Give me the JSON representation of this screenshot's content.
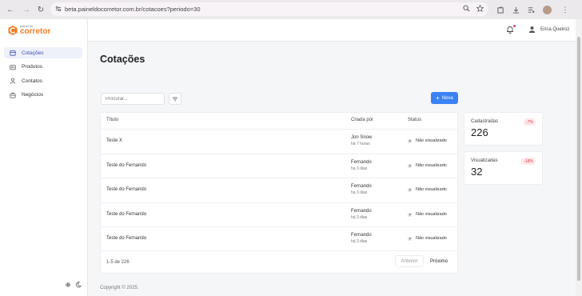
{
  "browser": {
    "url": "beta.paineldocorretor.com.br/cotacoes?periodo=30"
  },
  "brand": {
    "small": "painel do",
    "big": "corretor",
    "accent": "#f07b22"
  },
  "sidebar": {
    "items": [
      {
        "label": "Cotações",
        "icon": "quote-icon",
        "active": true
      },
      {
        "label": "Produtos",
        "icon": "products-icon",
        "active": false
      },
      {
        "label": "Contatos",
        "icon": "contacts-icon",
        "active": false
      },
      {
        "label": "Negócios",
        "icon": "business-icon",
        "active": false
      }
    ]
  },
  "header": {
    "user_name": "Erica Queiroz"
  },
  "main": {
    "title": "Cotações",
    "search_placeholder": "Procurar...",
    "new_button": "Nova",
    "table": {
      "headers": [
        "Título",
        "Criada por",
        "Status"
      ],
      "rows": [
        {
          "title": "Teste X",
          "author": "Jon Snow",
          "ago": "há 7 horas",
          "status": "Não visualizado"
        },
        {
          "title": "Teste do Fernando",
          "author": "Fernando",
          "ago": "há 3 dias",
          "status": "Não visualizado"
        },
        {
          "title": "Teste do Fernando",
          "author": "Fernando",
          "ago": "há 3 dias",
          "status": "Não visualizado"
        },
        {
          "title": "Teste do Fernando",
          "author": "Fernando",
          "ago": "há 3 dias",
          "status": "Não visualizado"
        },
        {
          "title": "Teste do Fernando",
          "author": "Fernando",
          "ago": "há 3 dias",
          "status": "Não visualizado"
        }
      ],
      "pagination": {
        "info": "1-5 de 226",
        "prev": "Anterior",
        "next": "Próximo"
      }
    },
    "stats": [
      {
        "label": "Cadastradas",
        "value": "226",
        "badge": "-7%"
      },
      {
        "label": "Visualizadas",
        "value": "32",
        "badge": "-18%"
      }
    ],
    "footer": "Copyright © 2025."
  }
}
